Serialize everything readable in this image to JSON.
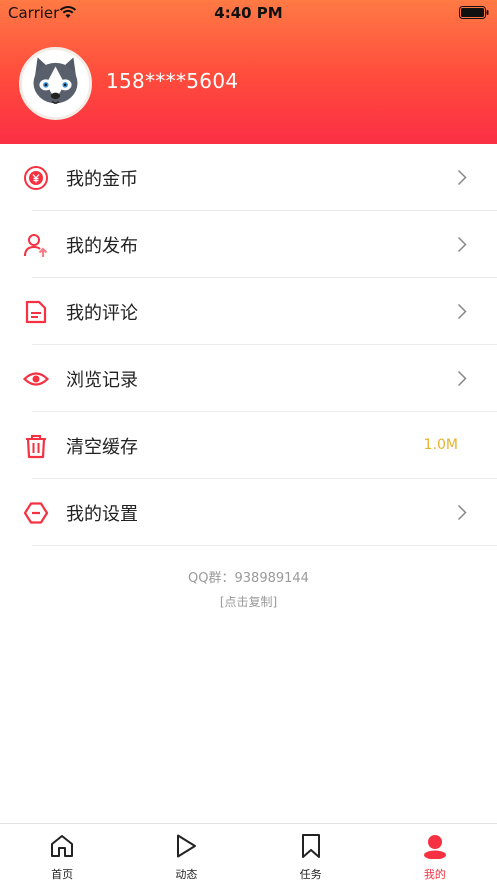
{
  "status_bar": {
    "carrier": "Carrier",
    "time": "4:40 PM"
  },
  "profile": {
    "phone": "158****5604"
  },
  "menu": [
    {
      "label": "我的金币",
      "icon": "coin-yen-icon",
      "chevron": true
    },
    {
      "label": "我的发布",
      "icon": "user-upload-icon",
      "chevron": true
    },
    {
      "label": "我的评论",
      "icon": "comment-doc-icon",
      "chevron": true
    },
    {
      "label": "浏览记录",
      "icon": "eye-icon",
      "chevron": true
    },
    {
      "label": "清空缓存",
      "icon": "trash-icon",
      "chevron": false,
      "value": "1.0M"
    },
    {
      "label": "我的设置",
      "icon": "settings-hexagon-icon",
      "chevron": true
    }
  ],
  "footer": {
    "qq_group": "QQ群：938989144",
    "copy_hint": "[点击复制]"
  },
  "tabbar": [
    {
      "label": "首页",
      "icon": "home-icon",
      "active": false
    },
    {
      "label": "动态",
      "icon": "play-icon",
      "active": false
    },
    {
      "label": "任务",
      "icon": "bookmark-icon",
      "active": false
    },
    {
      "label": "我的",
      "icon": "profile-icon",
      "active": true
    }
  ],
  "colors": {
    "accent": "#f53142",
    "cache_value": "#e6b330",
    "header_top": "#ff7a45",
    "header_bottom": "#fb2f45"
  }
}
